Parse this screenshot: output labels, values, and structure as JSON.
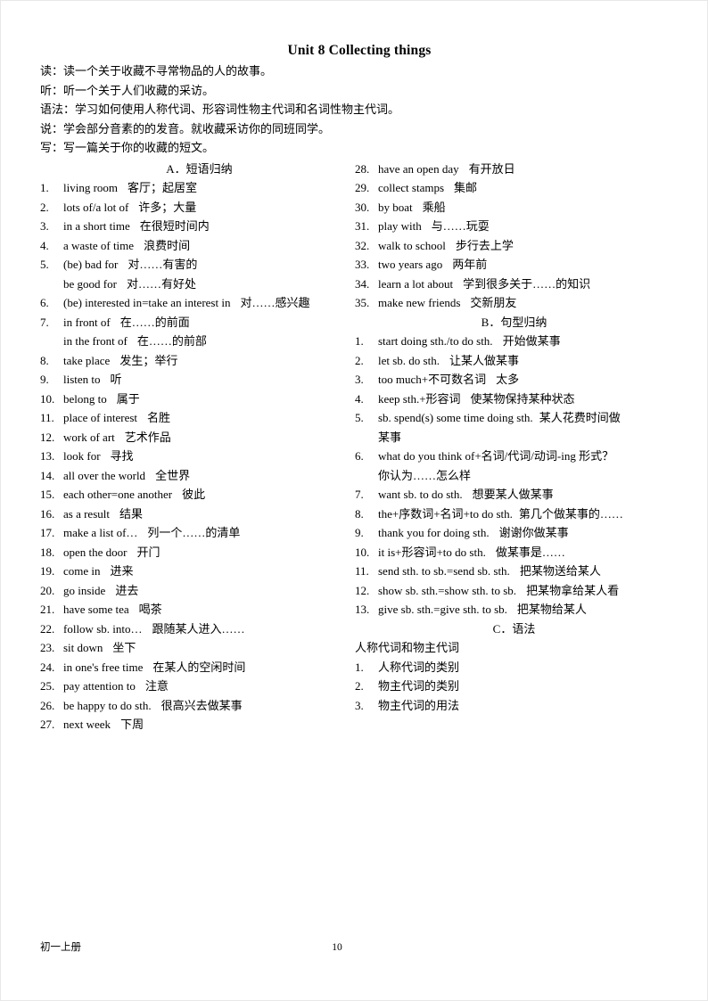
{
  "document": {
    "title": "Unit 8 Collecting things",
    "intro_lines": [
      "读：读一个关于收藏不寻常物品的人的故事。",
      "听：听一个关于人们收藏的采访。",
      "语法：学习如何使用人称代词、形容词性物主代词和名词性物主代词。",
      "说：学会部分音素的的发音。就收藏采访你的同班同学。",
      "写：写一篇关于你的收藏的短文。"
    ]
  },
  "sections": {
    "a": {
      "heading": "A．短语归纳",
      "items": [
        {
          "num": "1.",
          "en": "living room",
          "cn": "客厅；起居室"
        },
        {
          "num": "2.",
          "en": "lots of/a lot of",
          "cn": "许多；大量"
        },
        {
          "num": "3.",
          "en": "in a short time",
          "cn": "在很短时间内"
        },
        {
          "num": "4.",
          "en": "a waste of time",
          "cn": "浪费时间"
        },
        {
          "num": "5.",
          "en": "(be) bad for",
          "cn": "对……有害的"
        },
        {
          "num": "",
          "en": "be good for",
          "cn": "对……有好处",
          "sub": true
        },
        {
          "num": "6.",
          "en": "(be) interested in=take an interest in",
          "cn": "对……感兴趣"
        },
        {
          "num": "7.",
          "en": "in front of",
          "cn": "在……的前面"
        },
        {
          "num": "",
          "en": "in the front of",
          "cn": "在……的前部",
          "sub": true
        },
        {
          "num": "8.",
          "en": "take place",
          "cn": "发生；举行"
        },
        {
          "num": "9.",
          "en": "listen to",
          "cn": "听"
        },
        {
          "num": "10.",
          "en": "belong to",
          "cn": "属于"
        },
        {
          "num": "11.",
          "en": "place of interest",
          "cn": "名胜"
        },
        {
          "num": "12.",
          "en": "work of art",
          "cn": "艺术作品"
        },
        {
          "num": "13.",
          "en": "look for",
          "cn": "寻找"
        },
        {
          "num": "14.",
          "en": "all over the world",
          "cn": "全世界"
        },
        {
          "num": "15.",
          "en": "each other=one another",
          "cn": "彼此"
        },
        {
          "num": "16.",
          "en": "as a result",
          "cn": "结果"
        },
        {
          "num": "17.",
          "en": "make a list of…",
          "cn": "列一个……的清单"
        },
        {
          "num": "18.",
          "en": "open the door",
          "cn": "开门"
        },
        {
          "num": "19.",
          "en": "come in",
          "cn": "进来"
        },
        {
          "num": "20.",
          "en": "go inside",
          "cn": "进去"
        },
        {
          "num": "21.",
          "en": "have some tea",
          "cn": "喝茶"
        },
        {
          "num": "22.",
          "en": "follow sb. into…",
          "cn": "跟随某人进入……"
        },
        {
          "num": "23.",
          "en": "sit down",
          "cn": "坐下"
        },
        {
          "num": "24.",
          "en": "in one's free time",
          "cn": "在某人的空闲时间"
        },
        {
          "num": "25.",
          "en": "pay attention to",
          "cn": "注意"
        },
        {
          "num": "26.",
          "en": "be happy to do sth.",
          "cn": "很高兴去做某事"
        },
        {
          "num": "27.",
          "en": "next week",
          "cn": "下周"
        }
      ],
      "items_cont": [
        {
          "num": "28.",
          "en": "have an open day",
          "cn": "有开放日"
        },
        {
          "num": "29.",
          "en": "collect stamps",
          "cn": "集邮"
        },
        {
          "num": "30.",
          "en": "by boat",
          "cn": "乘船"
        },
        {
          "num": "31.",
          "en": "play with",
          "cn": "与……玩耍"
        },
        {
          "num": "32.",
          "en": "walk to school",
          "cn": "步行去上学"
        },
        {
          "num": "33.",
          "en": "two years ago",
          "cn": "两年前"
        },
        {
          "num": "34.",
          "en": "learn a lot about",
          "cn": "学到很多关于……的知识"
        },
        {
          "num": "35.",
          "en": "make new friends",
          "cn": "交新朋友"
        }
      ]
    },
    "b": {
      "heading": "B．句型归纳",
      "items": [
        {
          "num": "1.",
          "en": "start doing sth./to do sth.",
          "cn": "开始做某事"
        },
        {
          "num": "2.",
          "en": "let sb. do sth.",
          "cn": "让某人做某事"
        },
        {
          "num": "3.",
          "en": "too much+不可数名词",
          "cn": "太多"
        },
        {
          "num": "4.",
          "en": "keep sth.+形容词",
          "cn": "使某物保持某种状态"
        },
        {
          "num": "5.",
          "en": "sb. spend(s) some time doing sth.",
          "cn": "某人花费时间做",
          "cont": "某事"
        },
        {
          "num": "6.",
          "en": "what do you think of+名词/代词/动词-ing 形式？",
          "cn": "",
          "cont": "你认为……怎么样"
        },
        {
          "num": "7.",
          "en": "want sb. to do sth.",
          "cn": "想要某人做某事"
        },
        {
          "num": "8.",
          "en": "the+序数词+名词+to do sth.",
          "cn": "第几个做某事的……"
        },
        {
          "num": "9.",
          "en": "thank you for doing sth.",
          "cn": "谢谢你做某事"
        },
        {
          "num": "10.",
          "en": "it is+形容词+to do sth.",
          "cn": "做某事是……"
        },
        {
          "num": "11.",
          "en": "send sth. to sb.=send sb. sth.",
          "cn": "把某物送给某人"
        },
        {
          "num": "12.",
          "en": "show sb. sth.=show sth. to sb.",
          "cn": "把某物拿给某人看"
        },
        {
          "num": "13.",
          "en": "give sb. sth.=give sth. to sb.",
          "cn": "把某物给某人"
        }
      ]
    },
    "c": {
      "heading": "C．语法",
      "subtitle": "人称代词和物主代词",
      "items": [
        {
          "num": "1.",
          "cn": "人称代词的类别"
        },
        {
          "num": "2.",
          "cn": "物主代词的类别"
        },
        {
          "num": "3.",
          "cn": "物主代词的用法"
        }
      ]
    }
  },
  "footer": {
    "left": "初一上册",
    "page": "10"
  }
}
